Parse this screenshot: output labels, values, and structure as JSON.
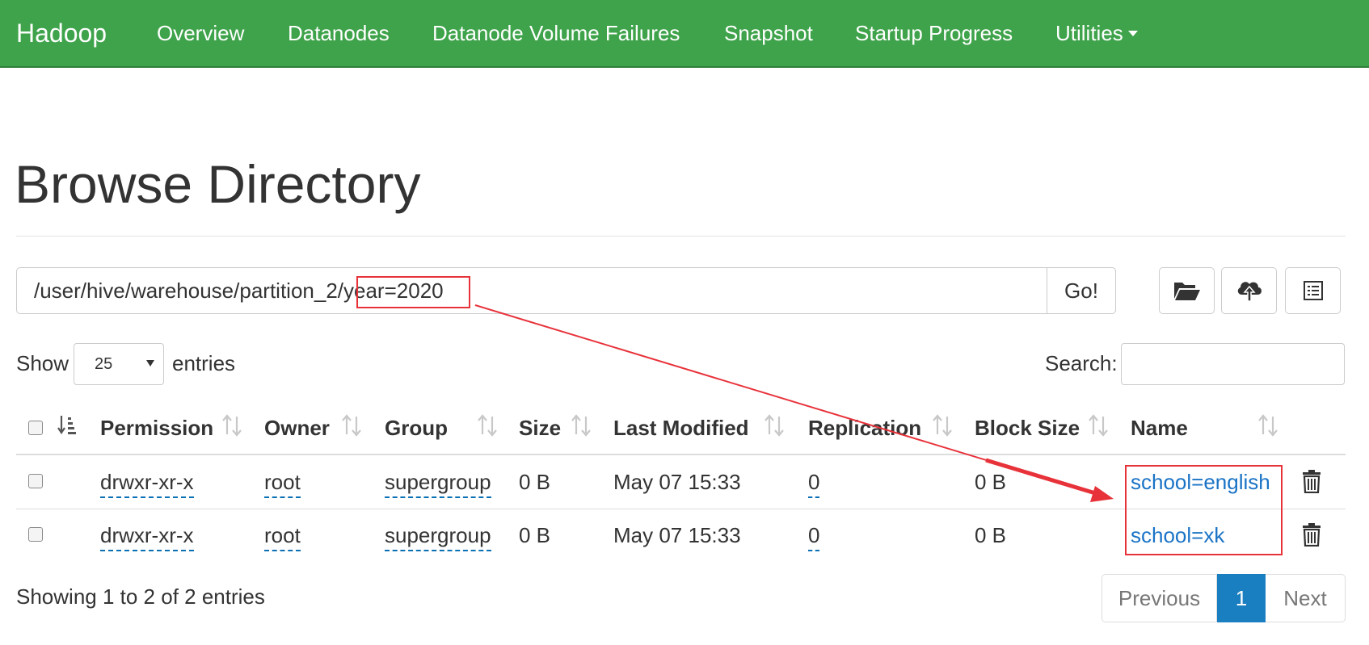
{
  "navbar": {
    "brand": "Hadoop",
    "items": [
      "Overview",
      "Datanodes",
      "Datanode Volume Failures",
      "Snapshot",
      "Startup Progress",
      "Utilities"
    ],
    "color": "#3ea34a"
  },
  "page_title": "Browse Directory",
  "path": {
    "prefix": "/user/hive/warehouse/partition_2/",
    "highlighted": "year=2020",
    "go_label": "Go!"
  },
  "toolbar": {
    "icons": [
      "folder-open-icon",
      "cloud-upload-icon",
      "list-icon"
    ]
  },
  "entries": {
    "show_label": "Show",
    "selected": "25",
    "suffix_label": "entries"
  },
  "search": {
    "label": "Search:",
    "value": ""
  },
  "table": {
    "columns": [
      "Permission",
      "Owner",
      "Group",
      "Size",
      "Last Modified",
      "Replication",
      "Block Size",
      "Name"
    ],
    "rows": [
      {
        "permission": "drwxr-xr-x",
        "owner": "root",
        "group": "supergroup",
        "size": "0 B",
        "modified": "May 07 15:33",
        "replication": "0",
        "block_size": "0 B",
        "name": "school=english"
      },
      {
        "permission": "drwxr-xr-x",
        "owner": "root",
        "group": "supergroup",
        "size": "0 B",
        "modified": "May 07 15:33",
        "replication": "0",
        "block_size": "0 B",
        "name": "school=xk"
      }
    ]
  },
  "footer": {
    "info": "Showing 1 to 2 of 2 entries",
    "previous": "Previous",
    "current_page": "1",
    "next": "Next"
  },
  "annotation": {
    "color": "#e8323a"
  }
}
